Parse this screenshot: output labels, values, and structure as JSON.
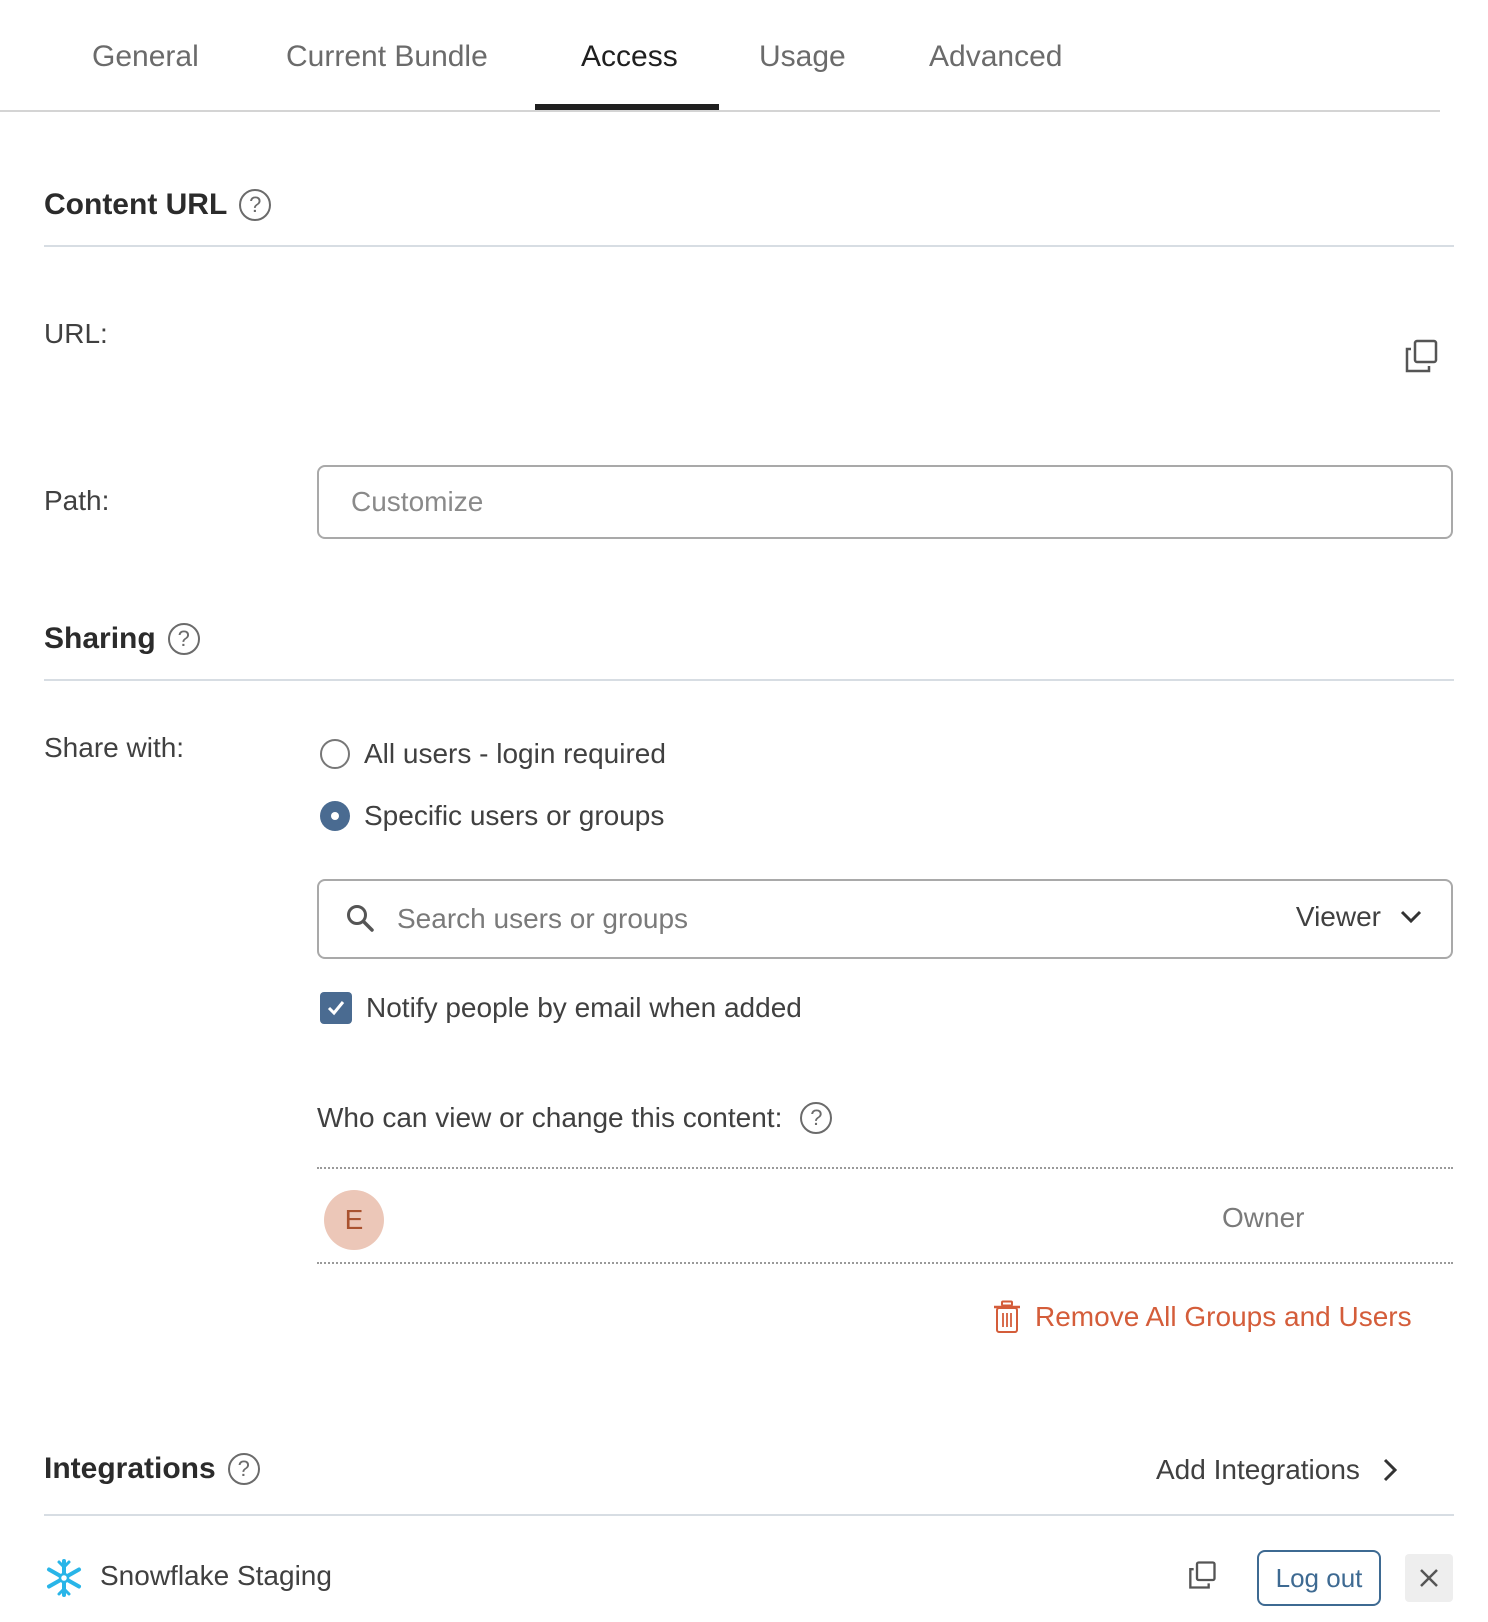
{
  "tabs": [
    {
      "label": "General"
    },
    {
      "label": "Current Bundle"
    },
    {
      "label": "Access",
      "active": true
    },
    {
      "label": "Usage"
    },
    {
      "label": "Advanced"
    }
  ],
  "content_url": {
    "title": "Content URL",
    "url_label": "URL:",
    "path_label": "Path:",
    "path_placeholder": "Customize"
  },
  "sharing": {
    "title": "Sharing",
    "share_with_label": "Share with:",
    "options": [
      {
        "label": "All users - login required",
        "selected": false
      },
      {
        "label": "Specific users or groups",
        "selected": true
      }
    ],
    "search_placeholder": "Search users or groups",
    "role_selected": "Viewer",
    "notify_label": "Notify people by email when added",
    "notify_checked": true,
    "who_label": "Who can view or change this content:",
    "members": [
      {
        "initial": "E",
        "role": "Owner"
      }
    ],
    "remove_all_label": "Remove All Groups and Users"
  },
  "integrations": {
    "title": "Integrations",
    "add_label": "Add Integrations",
    "items": [
      {
        "name": "Snowflake Staging",
        "logout_label": "Log out"
      }
    ]
  },
  "colors": {
    "accent": "#4a6b91",
    "danger": "#d45d3a",
    "snowflake": "#29b5e8"
  }
}
